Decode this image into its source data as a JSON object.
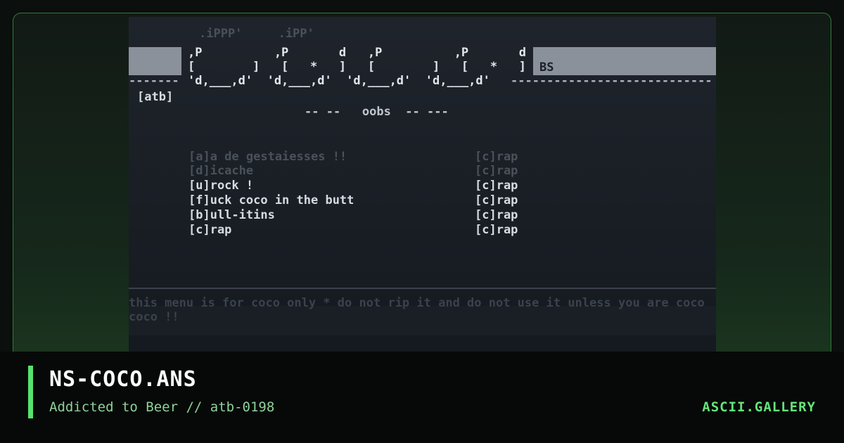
{
  "art": {
    "faint_top": ".iPPP'     .iPP'",
    "logo_row1": ",P          ,P       d   ,P          ,P       d",
    "logo_row2": "[        ]   [   *   ]   [        ]   [   *   ]",
    "logo_row3": "'d,___,d'  'd,___,d'  'd,___,d'  'd,___,d'",
    "bs_label": "BS",
    "dashes_left": "-------",
    "dashes_right": "----------------------------",
    "tag": "[atb]",
    "subtitle_line": "-- --   oobs  -- ---",
    "menu": [
      {
        "left": "[a]a de gestaiesses !!",
        "right": "[c]rap",
        "dim": true
      },
      {
        "left": "[d]icache",
        "right": "[c]rap",
        "dim": true
      },
      {
        "left": "[u]rock !",
        "right": "[c]rap",
        "dim": false
      },
      {
        "left": "[f]uck coco in the butt",
        "right": "[c]rap",
        "dim": false
      },
      {
        "left": "[b]ull-itins",
        "right": "[c]rap",
        "dim": false
      },
      {
        "left": "[c]rap",
        "right": "[c]rap",
        "dim": false
      }
    ],
    "footer_line1": "this menu is for coco only * do not rip it and do not use it unless you are coco",
    "footer_line2": "coco !!"
  },
  "card": {
    "title": "NS-COCO.ANS",
    "subtitle": "Addicted to Beer // atb-0198",
    "brand": "ASCII.GALLERY"
  },
  "colors": {
    "accent": "#57e36b",
    "brand": "#66e37a",
    "subtitle": "#8fd199"
  }
}
